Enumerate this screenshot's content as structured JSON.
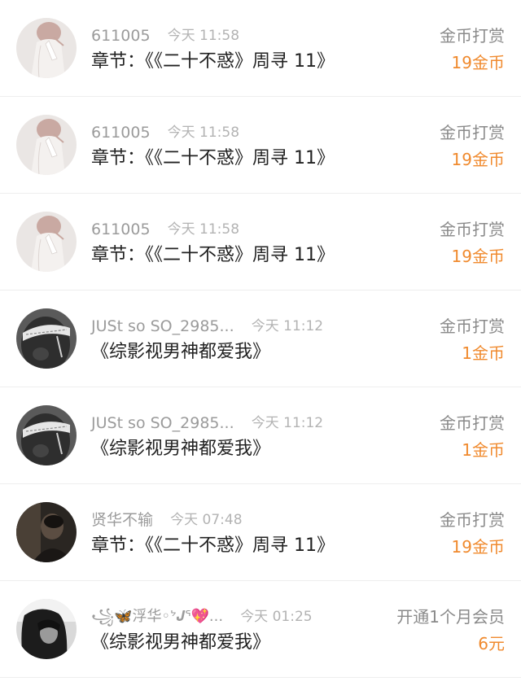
{
  "colors": {
    "accent_orange": "#f08a2e",
    "meta_gray": "#9b9b9b",
    "title_dark": "#222222",
    "divider": "#eeeeee"
  },
  "rows": [
    {
      "username": "611005",
      "time": "今天 11:58",
      "title": "章节：《《二十不惑》周寻 11》",
      "gift_type": "金币打赏",
      "amount": "19金币",
      "avatar_icon": "woman-back-illustration-avatar"
    },
    {
      "username": "611005",
      "time": "今天 11:58",
      "title": "章节：《《二十不惑》周寻 11》",
      "gift_type": "金币打赏",
      "amount": "19金币",
      "avatar_icon": "woman-back-illustration-avatar"
    },
    {
      "username": "611005",
      "time": "今天 11:58",
      "title": "章节：《《二十不惑》周寻 11》",
      "gift_type": "金币打赏",
      "amount": "19金币",
      "avatar_icon": "woman-back-illustration-avatar"
    },
    {
      "username": "JUSt so SO_2985...",
      "time": "今天 11:12",
      "title": "《综影视男神都爱我》",
      "gift_type": "金币打赏",
      "amount": "1金币",
      "avatar_icon": "man-bandana-bw-avatar"
    },
    {
      "username": "JUSt so SO_2985...",
      "time": "今天 11:12",
      "title": "《综影视男神都爱我》",
      "gift_type": "金币打赏",
      "amount": "1金币",
      "avatar_icon": "man-bandana-bw-avatar"
    },
    {
      "username": "贤华不输",
      "time": "今天 07:48",
      "title": "章节：《《二十不惑》周寻 11》",
      "gift_type": "金币打赏",
      "amount": "19金币",
      "avatar_icon": "dark-portrait-avatar"
    },
    {
      "username": "꧁🦋浮华◦ᔾ𝑱ᕐ💖...",
      "time": "今天 01:25",
      "title": "《综影视男神都爱我》",
      "gift_type": "开通1个月会员",
      "amount": "6元",
      "avatar_icon": "bw-girl-portrait-avatar"
    }
  ]
}
